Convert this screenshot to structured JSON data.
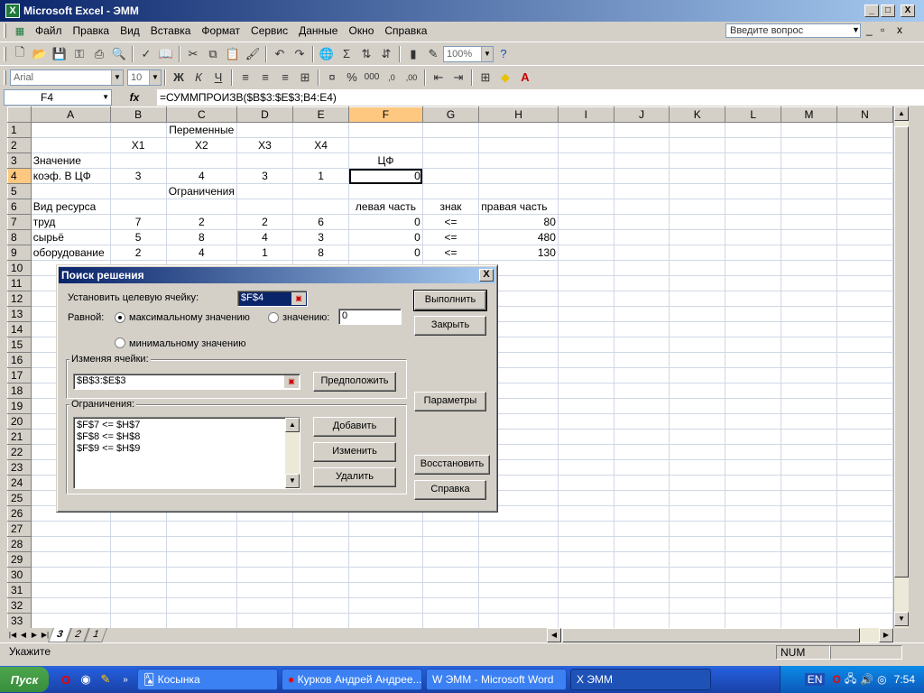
{
  "window": {
    "title": "Microsoft Excel - ЭММ",
    "min": "_",
    "max": "□",
    "close": "X",
    "child_min": "_",
    "child_restore": "▫",
    "child_close": "x"
  },
  "menu": [
    "Файл",
    "Правка",
    "Вид",
    "Вставка",
    "Формат",
    "Сервис",
    "Данные",
    "Окно",
    "Справка"
  ],
  "help_box": "Введите вопрос",
  "toolbar": {
    "zoom": "100%",
    "font": "Arial",
    "size": "10",
    "bold": "Ж",
    "italic": "К",
    "underline": "Ч"
  },
  "formula_bar": {
    "cell": "F4",
    "fx": "fx",
    "formula": "=СУММПРОИЗВ($B$3:$E$3;B4:E4)"
  },
  "columns": [
    "A",
    "B",
    "C",
    "D",
    "E",
    "F",
    "G",
    "H",
    "I",
    "J",
    "K",
    "L",
    "M",
    "N"
  ],
  "rows": [
    [
      "",
      "",
      "Переменные",
      "",
      "",
      "",
      "",
      "",
      ""
    ],
    [
      "",
      "X1",
      "X2",
      "X3",
      "X4",
      "",
      "",
      "",
      ""
    ],
    [
      "Значение",
      "",
      "",
      "",
      "",
      "ЦФ",
      "",
      "",
      ""
    ],
    [
      "коэф. В ЦФ",
      "3",
      "4",
      "3",
      "1",
      "0",
      "",
      "",
      ""
    ],
    [
      "",
      "",
      "Ограничения",
      "",
      "",
      "",
      "",
      "",
      ""
    ],
    [
      "Вид ресурса",
      "",
      "",
      "",
      "",
      "левая часть",
      "знак",
      "правая часть",
      ""
    ],
    [
      "труд",
      "7",
      "2",
      "2",
      "6",
      "0",
      "<=",
      "80",
      ""
    ],
    [
      "сырьё",
      "5",
      "8",
      "4",
      "3",
      "0",
      "<=",
      "480",
      ""
    ],
    [
      "оборудование",
      "2",
      "4",
      "1",
      "8",
      "0",
      "<=",
      "130",
      ""
    ]
  ],
  "row_numbers": [
    "1",
    "2",
    "3",
    "4",
    "5",
    "6",
    "7",
    "8",
    "9",
    "10",
    "11",
    "12",
    "13",
    "14",
    "15",
    "16",
    "17",
    "18",
    "19",
    "20",
    "21",
    "22",
    "23",
    "24",
    "25",
    "26",
    "27",
    "28",
    "29",
    "30",
    "31",
    "32",
    "33"
  ],
  "sheet_tabs": [
    "3",
    "2",
    "1"
  ],
  "status": {
    "left": "Укажите",
    "num": "NUM"
  },
  "dialog": {
    "title": "Поиск решения",
    "close": "X",
    "target_label": "Установить целевую ячейку:",
    "target_value": "$F$4",
    "equal_label": "Равной:",
    "opt_max": "максимальному значению",
    "opt_value": "значению:",
    "value_field": "0",
    "opt_min": "минимальному значению",
    "changing_label": "Изменяя ячейки:",
    "changing_value": "$B$3:$E$3",
    "guess_btn": "Предположить",
    "constraints_label": "Ограничения:",
    "constraints": [
      "$F$7 <= $H$7",
      "$F$8 <= $H$8",
      "$F$9 <= $H$9"
    ],
    "add_btn": "Добавить",
    "change_btn": "Изменить",
    "delete_btn": "Удалить",
    "solve_btn": "Выполнить",
    "close_btn": "Закрыть",
    "options_btn": "Параметры",
    "reset_btn": "Восстановить",
    "help_btn": "Справка"
  },
  "taskbar": {
    "start": "Пуск",
    "items": [
      "Косынка",
      "Курков Андрей Андрее...",
      "ЭММ - Microsoft Word",
      "ЭММ"
    ],
    "lang": "EN",
    "clock": "7:54"
  }
}
